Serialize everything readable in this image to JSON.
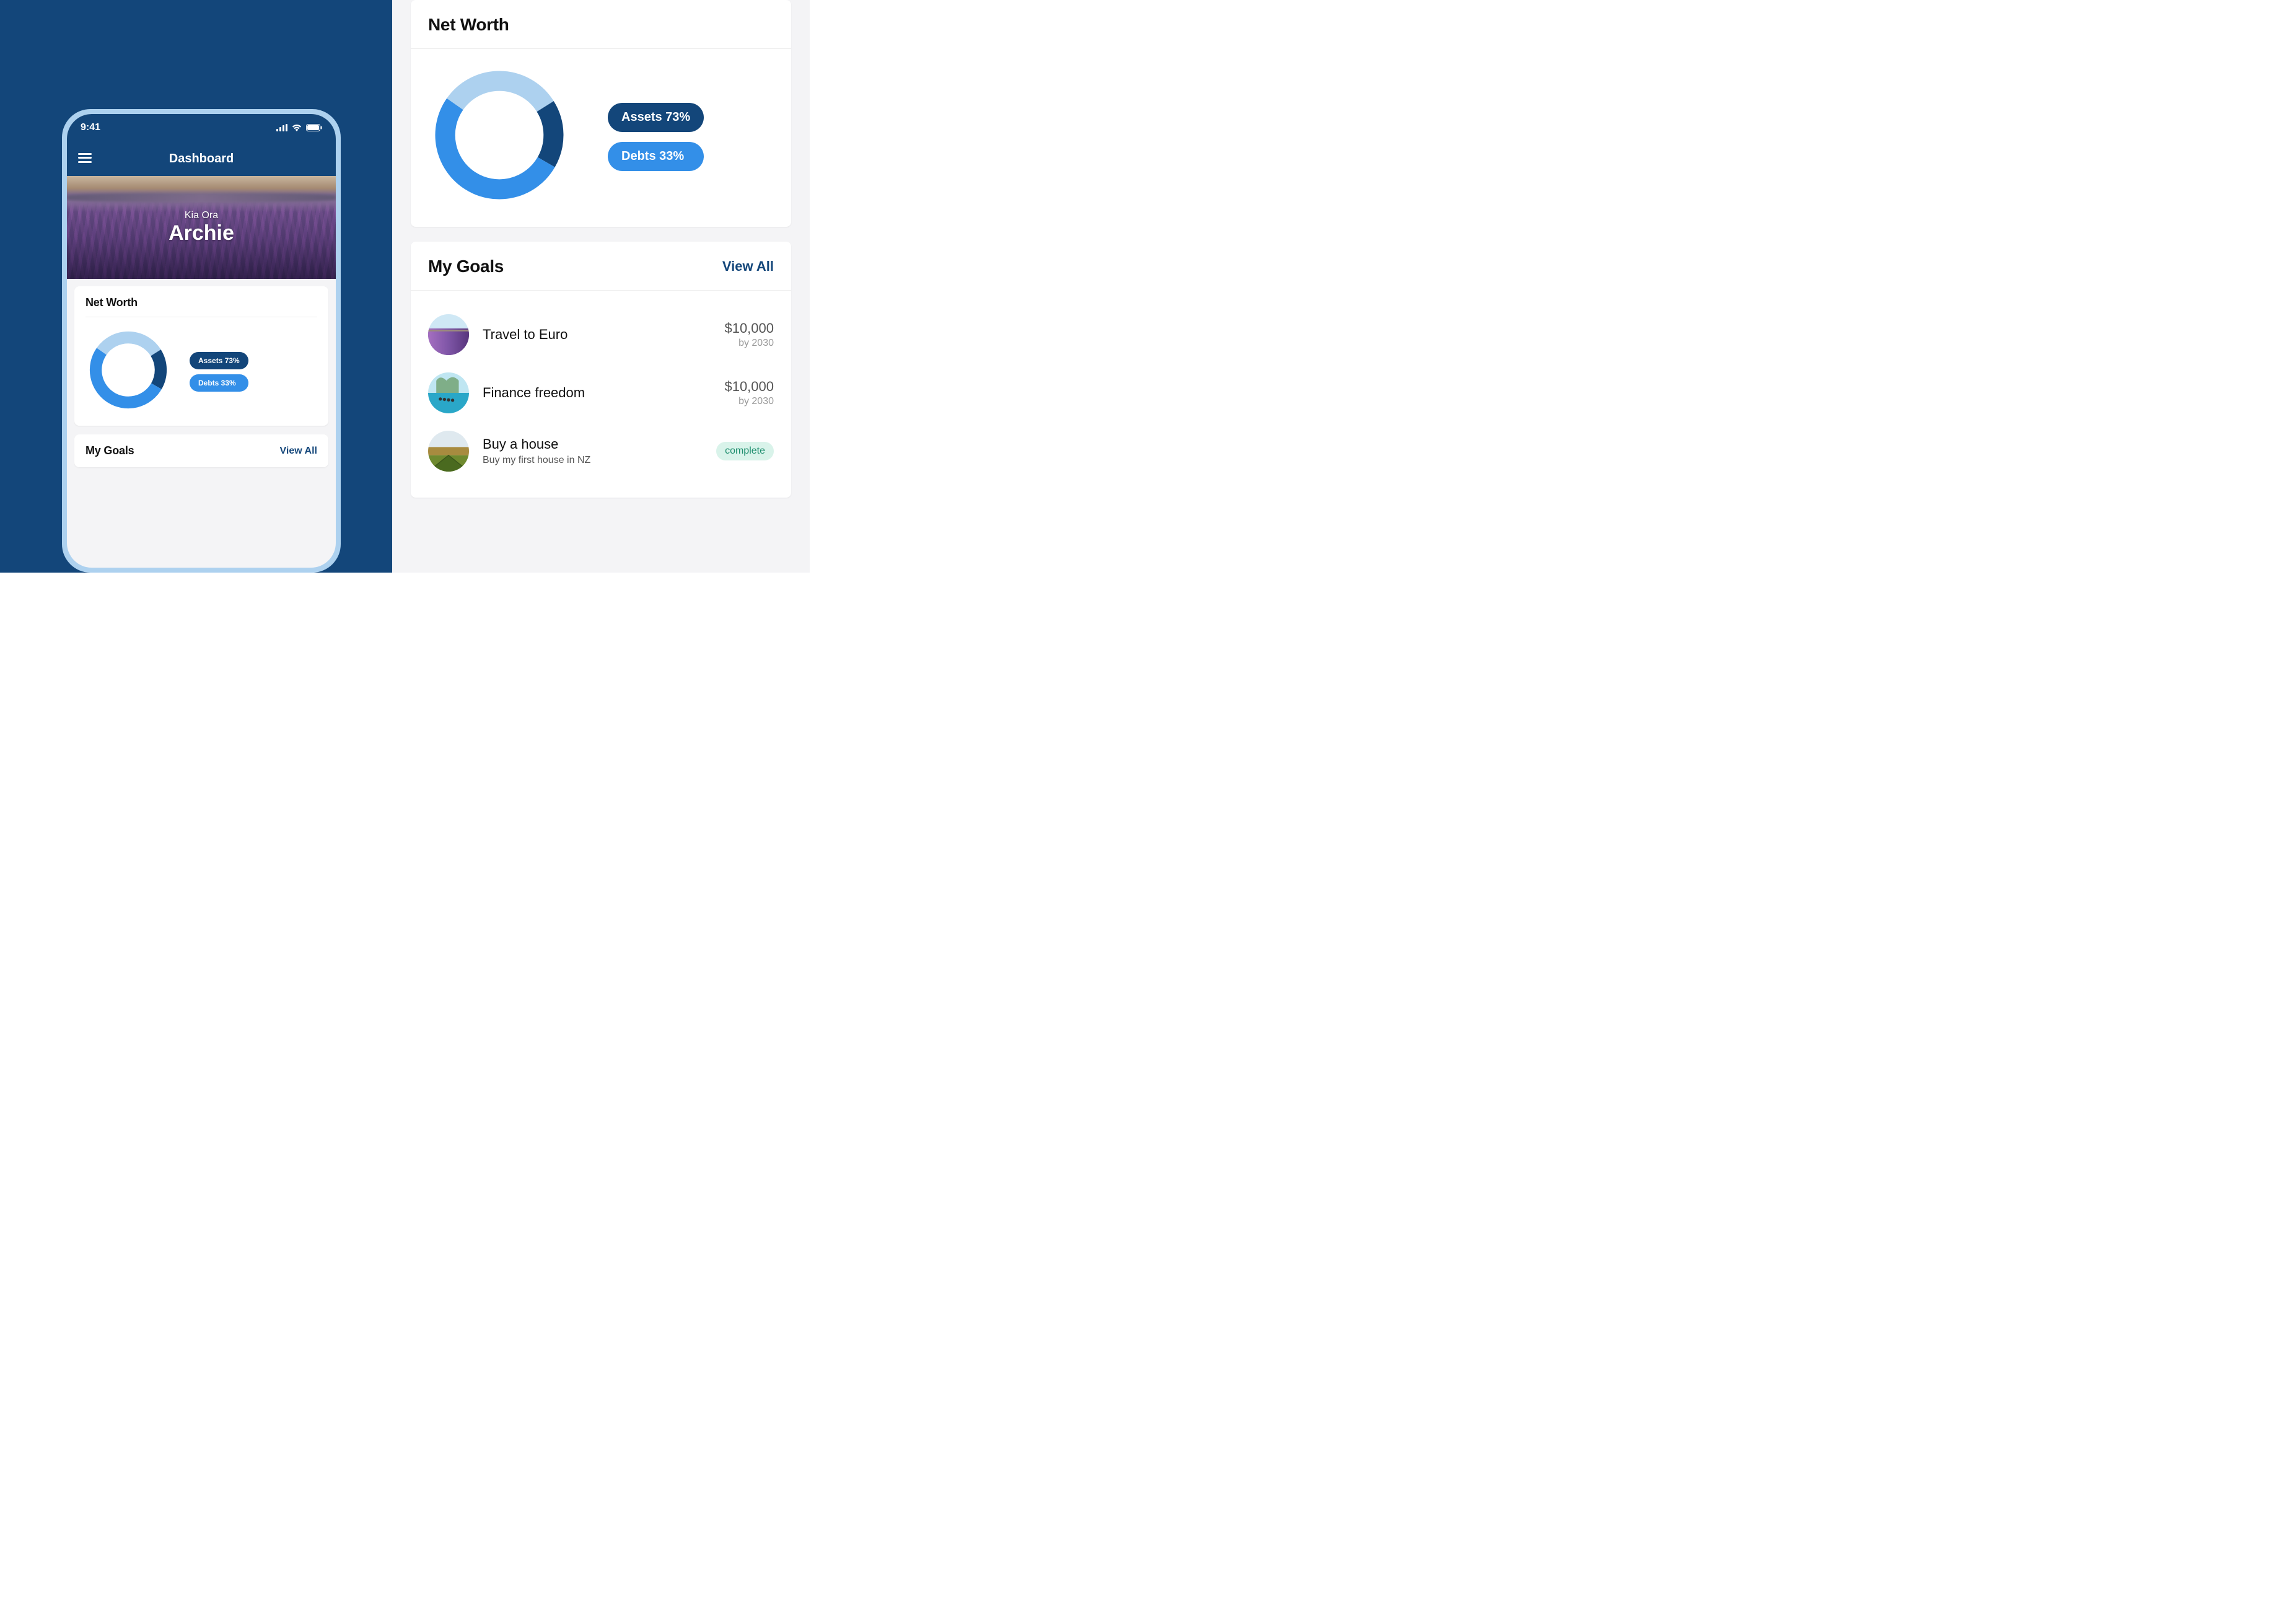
{
  "statusbar": {
    "time": "9:41"
  },
  "header": {
    "title": "Dashboard"
  },
  "hero": {
    "greeting": "Kia Ora",
    "name": "Archie"
  },
  "networth": {
    "title": "Net Worth",
    "assets_label": "Assets 73%",
    "debts_label": "Debts 33%"
  },
  "mygoals": {
    "title": "My Goals",
    "viewall_label": "View All",
    "items": [
      {
        "name": "Travel to Euro",
        "sub": "",
        "amount": "$10,000",
        "by": "by 2030",
        "status": ""
      },
      {
        "name": "Finance freedom",
        "sub": "",
        "amount": "$10,000",
        "by": "by 2030",
        "status": ""
      },
      {
        "name": "Buy a house",
        "sub": "Buy my first house in NZ",
        "amount": "",
        "by": "",
        "status": "complete"
      }
    ]
  },
  "chart_data": {
    "type": "pie",
    "title": "Net Worth",
    "series": [
      {
        "name": "Assets",
        "values": [
          73
        ],
        "color": "#13467A"
      },
      {
        "name": "Debts",
        "values": [
          33
        ],
        "color": "#338FE8"
      }
    ],
    "ring_segments_deg": [
      {
        "color": "#ADD1EF",
        "start": 0,
        "end": 58
      },
      {
        "color": "#13467A",
        "start": 58,
        "end": 120
      },
      {
        "color": "#338FE8",
        "start": 120,
        "end": 305
      },
      {
        "color": "#ADD1EF",
        "start": 305,
        "end": 360
      }
    ]
  },
  "colors": {
    "primary": "#13467A",
    "accent": "#338FE8",
    "ring_light": "#ADD1EF"
  }
}
